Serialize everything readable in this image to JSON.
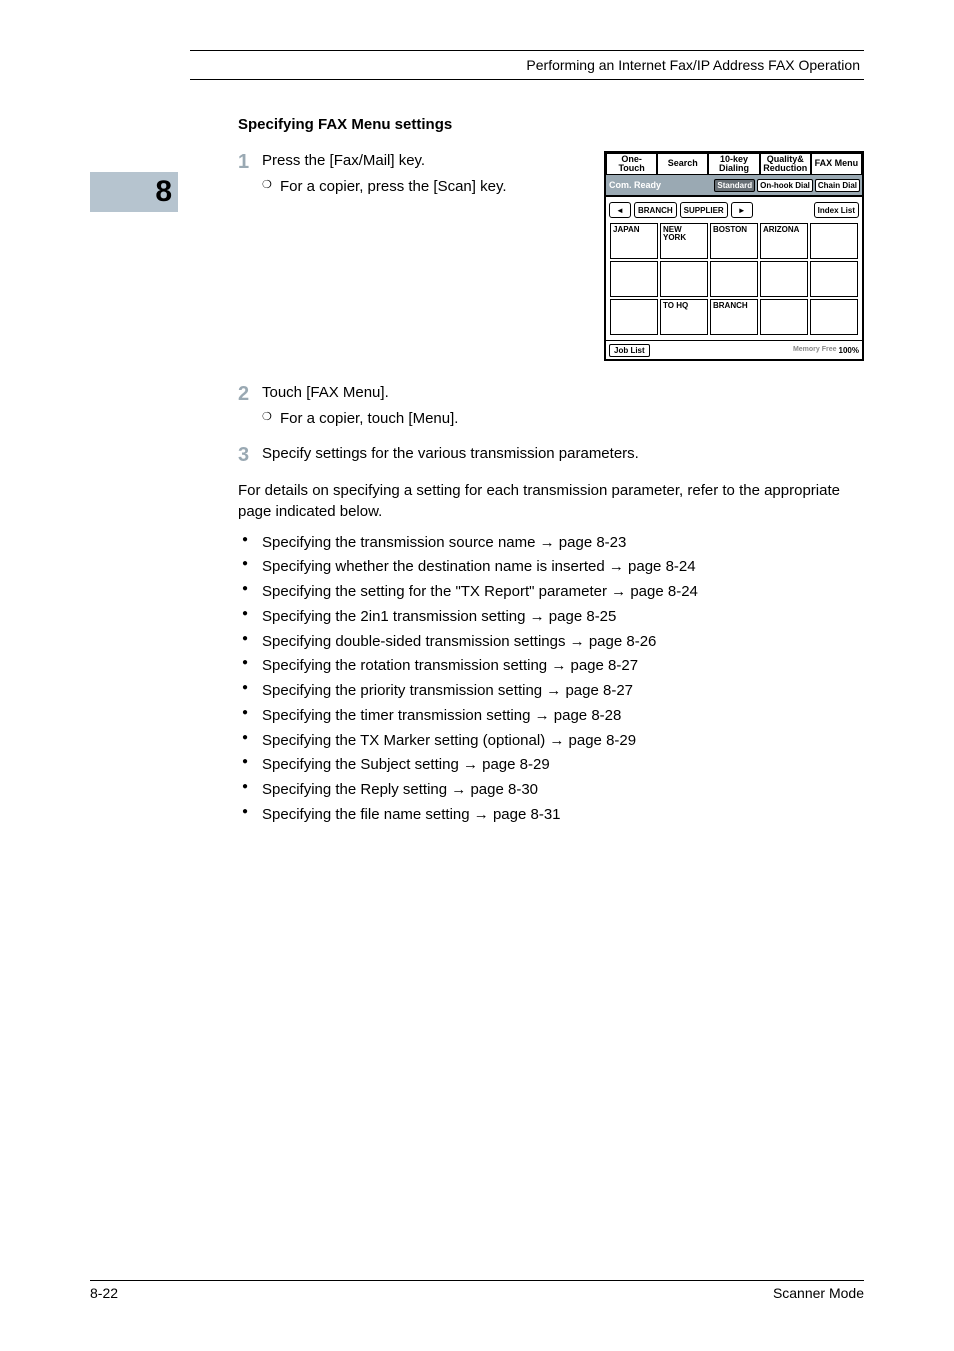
{
  "header": {
    "running": "Performing an Internet Fax/IP Address FAX Operation"
  },
  "chapter": {
    "num": "8"
  },
  "section": {
    "title": "Specifying FAX Menu settings"
  },
  "steps": {
    "s1": {
      "num": "1",
      "text": "Press the [Fax/Mail] key.",
      "sub": "For a copier, press the [Scan] key."
    },
    "s2": {
      "num": "2",
      "text": "Touch [FAX Menu].",
      "sub": "For a copier, touch [Menu]."
    },
    "s3": {
      "num": "3",
      "text": "Specify settings for the various transmission parameters."
    }
  },
  "para": "For details on specifying a setting for each transmission parameter, refer to the appropriate page indicated below.",
  "bullets": [
    "Specifying the transmission source name → page 8-23",
    "Specifying whether the destination name is inserted → page 8-24",
    "Specifying the setting for the \"TX Report\" parameter → page 8-24",
    "Specifying the 2in1 transmission setting → page 8-25",
    "Specifying double-sided transmission settings → page 8-26",
    "Specifying the rotation transmission setting → page 8-27",
    "Specifying the priority transmission setting → page 8-27",
    "Specifying the timer transmission setting → page 8-28",
    "Specifying the TX Marker setting (optional) → page 8-29",
    "Specifying the Subject setting → page 8-29",
    "Specifying the Reply setting → page 8-30",
    "Specifying the file name setting → page 8-31"
  ],
  "device": {
    "tabs": [
      "One-Touch",
      "Search",
      "10-key Dialing",
      "Quality& Reduction",
      "FAX Menu"
    ],
    "status": "Com. Ready",
    "status_pills": {
      "standard": "Standard",
      "onhook": "On-hook Dial",
      "chain": "Chain Dial"
    },
    "nav": {
      "branch": "BRANCH",
      "supplier": "SUPPLIER",
      "index": "Index List"
    },
    "cells": {
      "r1": [
        "JAPAN",
        "NEW YORK",
        "BOSTON",
        "ARIZONA",
        ""
      ],
      "r2": [
        "",
        "",
        "",
        "",
        ""
      ],
      "r3": [
        "",
        "TO HQ",
        "BRANCH",
        "",
        ""
      ]
    },
    "joblist": "Job List",
    "memory_label": "Memory Free",
    "memory_value": "100%"
  },
  "footer": {
    "left": "8-22",
    "right": "Scanner Mode"
  }
}
